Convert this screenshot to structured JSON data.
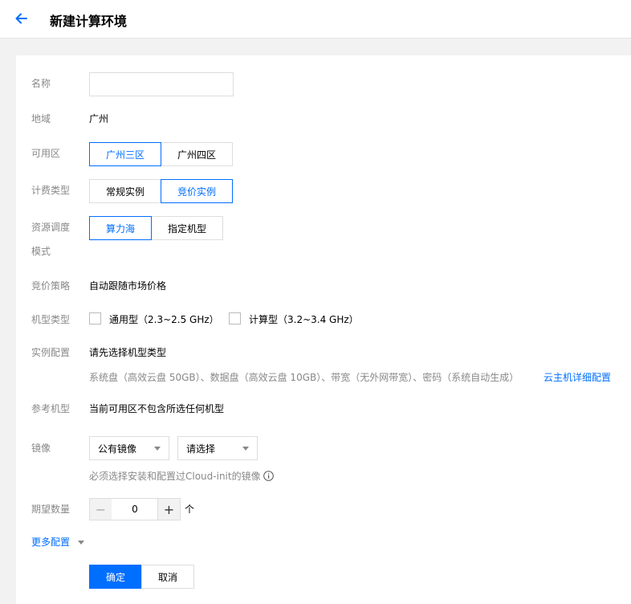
{
  "header": {
    "title": "新建计算环境",
    "back_icon": "arrow-left-icon",
    "accent": "#006eff"
  },
  "form": {
    "name": {
      "label": "名称",
      "value": "",
      "placeholder": ""
    },
    "region": {
      "label": "地域",
      "value": "广州"
    },
    "zone": {
      "label": "可用区",
      "options": [
        "广州三区",
        "广州四区"
      ],
      "selected": "广州三区"
    },
    "billing": {
      "label": "计费类型",
      "options": [
        "常规实例",
        "竞价实例"
      ],
      "selected": "竞价实例"
    },
    "scheduling": {
      "label_line1": "资源调度",
      "label_line2": "模式",
      "options": [
        "算力海",
        "指定机型"
      ],
      "selected": "算力海"
    },
    "bid_strategy": {
      "label": "竞价策略",
      "value": "自动跟随市场价格"
    },
    "instance_type": {
      "label": "机型类型",
      "options": [
        "通用型（2.3~2.5 GHz）",
        "计算型（3.2~3.4 GHz）"
      ]
    },
    "instance_config": {
      "label": "实例配置",
      "value": "请先选择机型类型",
      "detail": "系统盘（高效云盘 50GB）、数据盘（高效云盘 10GB）、带宽（无外网带宽）、密码（系统自动生成）",
      "link": "云主机详细配置"
    },
    "reference_model": {
      "label": "参考机型",
      "value": "当前可用区不包含所选任何机型"
    },
    "image": {
      "label": "镜像",
      "source": "公有镜像",
      "choice": "请选择",
      "hint": "必须选择安装和配置过Cloud-init的镜像",
      "hint_icon": "info-icon"
    },
    "quantity": {
      "label": "期望数量",
      "value": "0",
      "unit": "个",
      "minus": "−",
      "plus": "+"
    },
    "more": {
      "label": "更多配置",
      "icon": "caret-down-icon"
    }
  },
  "actions": {
    "confirm": "确定",
    "cancel": "取消"
  }
}
